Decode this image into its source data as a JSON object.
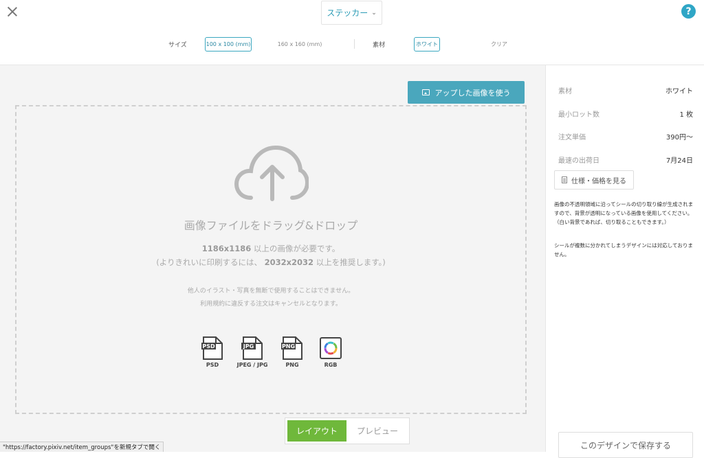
{
  "header": {
    "product_selector": "ステッカー",
    "size_label": "サイズ",
    "size_options": [
      "100 x 100 (mm)",
      "160 x 160 (mm)"
    ],
    "material_label": "素材",
    "material_options": [
      "ホワイト",
      "クリア"
    ],
    "help_label": "?"
  },
  "canvas": {
    "upload_button": "アップした画像を使う",
    "drop_title": "画像ファイルをドラッグ&ドロップ",
    "req_line1_size": "1186x1186",
    "req_line1_text": " 以上の画像が必要です。",
    "req_line2_prefix": "(よりきれいに印刷するには、 ",
    "req_line2_size": "2032x2032",
    "req_line2_suffix": " 以上を推奨します。)",
    "note_line1": "他人のイラスト・写真を無断で使用することはできません。",
    "note_line2": "利用規約に違反する注文はキャンセルとなります。",
    "formats": [
      {
        "badge": "PSD",
        "caption": "PSD"
      },
      {
        "badge": "JPG",
        "caption": "JPEG / JPG"
      },
      {
        "badge": "PNG",
        "caption": "PNG"
      },
      {
        "badge": "",
        "caption": "RGB"
      }
    ],
    "view_tabs": [
      "レイアウト",
      "プレビュー"
    ]
  },
  "sidebar": {
    "specs": [
      {
        "key": "素材",
        "value": "ホワイト"
      },
      {
        "key": "最小ロット数",
        "value": "1 枚"
      },
      {
        "key": "注文単価",
        "value": "390円〜"
      },
      {
        "key": "最速の出荷日",
        "value": "7月24日"
      }
    ],
    "spec_button": "仕様・価格を見る",
    "description1": "画像の不透明領域に沿ってシールの切り取り線が生成されますので、背景が透明になっている画像を使用してください。（白い背景であれば、切り取ることもできます。）",
    "description2": "シールが複数に分かれてしまうデザインには対応しておりません。",
    "save_button": "このデザインで保存する"
  },
  "status_bar": "\"https://factory.pixiv.net/item_groups\"を新規タブで開く",
  "colors": {
    "accent": "#4aa7bd",
    "layout_active": "#6fb83b",
    "help": "#2fa6c6"
  }
}
